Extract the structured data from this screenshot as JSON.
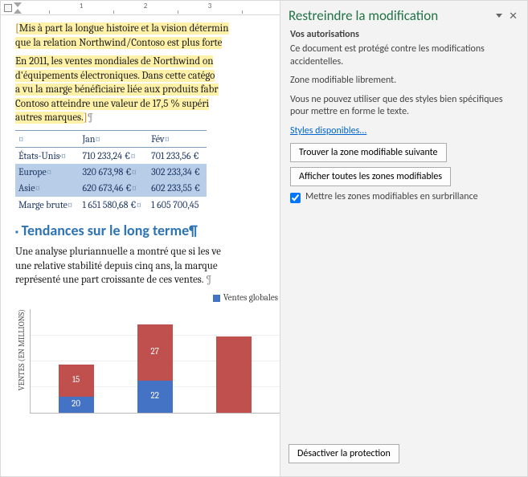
{
  "ruler": {
    "marks": [
      "1",
      "2",
      "3"
    ]
  },
  "doc": {
    "p1": "Mis à part la longue histoire et la vision détermin",
    "p1b": "que la relation Northwind/Contoso est plus forte",
    "p2a": "En 2011, les ventes mondiales de Northwind on",
    "p2b": "d'équipements électroniques. Dans cette catégo",
    "p2c": "a vu la marge bénéficiaire liée aux produits fabr",
    "p2d": "Contoso atteindre une valeur de 17,5 % supéri",
    "p2e": "autres marques.",
    "pilcrow": "¶",
    "heading": "Tendances sur le long terme",
    "p3a": "Une analyse pluriannuelle a montré que si les ve",
    "p3b": "une relative stabilité depuis cinq ans, la marque",
    "p3c": "représenté une part croissante de ces ventes. "
  },
  "table": {
    "head": [
      "",
      "Jan",
      "Fév"
    ],
    "rows": [
      {
        "label": "États-Unis·",
        "jan": "710 233,24 €",
        "fev": "701 233,56 €",
        "sel": false
      },
      {
        "label": "Europe",
        "jan": "320 673,98 €",
        "fev": "302 233,34 €",
        "sel": true
      },
      {
        "label": "Asie",
        "jan": "620 673,46 €",
        "fev": "602 233,55 €",
        "sel": true
      },
      {
        "label": "Marge brute",
        "jan": "1 651 580,68 €",
        "fev": "1 605 700,45",
        "sel": false
      }
    ],
    "cellmark": "¤"
  },
  "chart_data": {
    "type": "bar",
    "legend": "Ventes globales",
    "ylabel": "VENTES (EN MILLIONS)",
    "series": [
      {
        "name": "red",
        "color": "#c0504d",
        "values": [
          15,
          27,
          null
        ]
      },
      {
        "name": "blue",
        "color": "#4472c4",
        "values": [
          20,
          22,
          null
        ]
      }
    ],
    "categories": [
      "",
      "",
      ""
    ],
    "visible_bars": [
      {
        "red": 15,
        "blue": 20,
        "red_h": 40,
        "blue_h": 20
      },
      {
        "red": 27,
        "blue": 22,
        "red_h": 70,
        "blue_h": 40
      },
      {
        "red": "",
        "blue": "",
        "red_h": 95,
        "blue_h": 0
      }
    ]
  },
  "pane": {
    "title": "Restreindre la modification",
    "subtitle": "Vos autorisations",
    "prot1": "Ce document est protégé contre les modifications accidentelles.",
    "prot2": "Zone modifiable librement.",
    "styles1": "Vous ne pouvez utiliser que des styles bien spécifiques pour mettre en forme le texte.",
    "link": "Styles disponibles...",
    "btn1": "Trouver la zone modifiable suivante",
    "btn2": "Afficher toutes les zones modifiables",
    "check": "Mettre les zones modifiables en surbrillance",
    "footer_btn": "Désactiver la protection"
  }
}
